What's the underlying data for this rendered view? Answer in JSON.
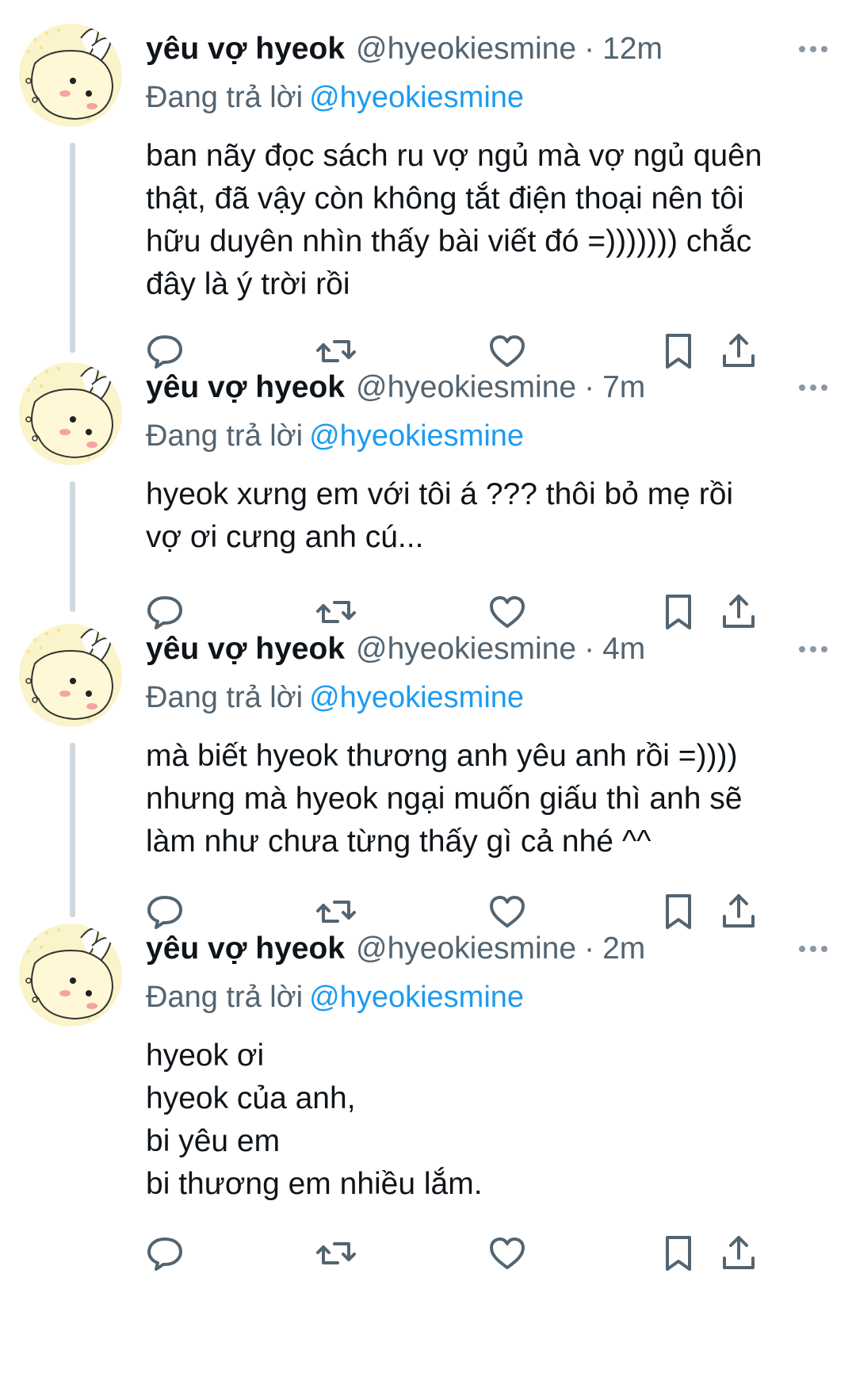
{
  "tweets": [
    {
      "name": "yêu vợ hyeok",
      "handle": "@hyeokiesmine",
      "dot": "·",
      "time": "12m",
      "reply_prefix": "Đang trả lời",
      "reply_to": "@hyeokiesmine",
      "lines": [
        "ban nãy đọc sách ru vợ ngủ mà vợ ngủ quên",
        "thật, đã vậy còn không tắt điện thoại nên tôi",
        "hữu duyên nhìn thấy bài viết đó =))))))) chắc",
        "đây là ý trời rồi"
      ]
    },
    {
      "name": "yêu vợ hyeok",
      "handle": "@hyeokiesmine",
      "dot": "·",
      "time": "7m",
      "reply_prefix": "Đang trả lời",
      "reply_to": "@hyeokiesmine",
      "lines": [
        "hyeok xưng em với tôi á ??? thôi bỏ mẹ rồi",
        "vợ ơi cưng anh cú..."
      ]
    },
    {
      "name": "yêu vợ hyeok",
      "handle": "@hyeokiesmine",
      "dot": "·",
      "time": "4m",
      "reply_prefix": "Đang trả lời",
      "reply_to": "@hyeokiesmine",
      "lines": [
        "mà biết hyeok thương anh yêu anh rồi =))))",
        "nhưng mà hyeok ngại muốn giấu thì anh sẽ",
        "làm như chưa từng thấy gì cả nhé ^^"
      ]
    },
    {
      "name": "yêu vợ hyeok",
      "handle": "@hyeokiesmine",
      "dot": "·",
      "time": "2m",
      "reply_prefix": "Đang trả lời",
      "reply_to": "@hyeokiesmine",
      "lines": [
        "hyeok ơi",
        "hyeok của anh,",
        "bi yêu em",
        "bi thương em nhiều lắm."
      ]
    }
  ],
  "icons": {
    "avatar": "bunny-avatar-icon",
    "more": "more-horizontal-icon",
    "reply": "reply-icon",
    "retweet": "retweet-icon",
    "like": "heart-icon",
    "bookmark": "bookmark-icon",
    "share": "share-icon"
  },
  "colors": {
    "text": "#0f1419",
    "secondary": "#536471",
    "mention": "#1d9bf0",
    "thread_line": "#cfd9de",
    "avatar_bg": "#fbf3c9"
  }
}
